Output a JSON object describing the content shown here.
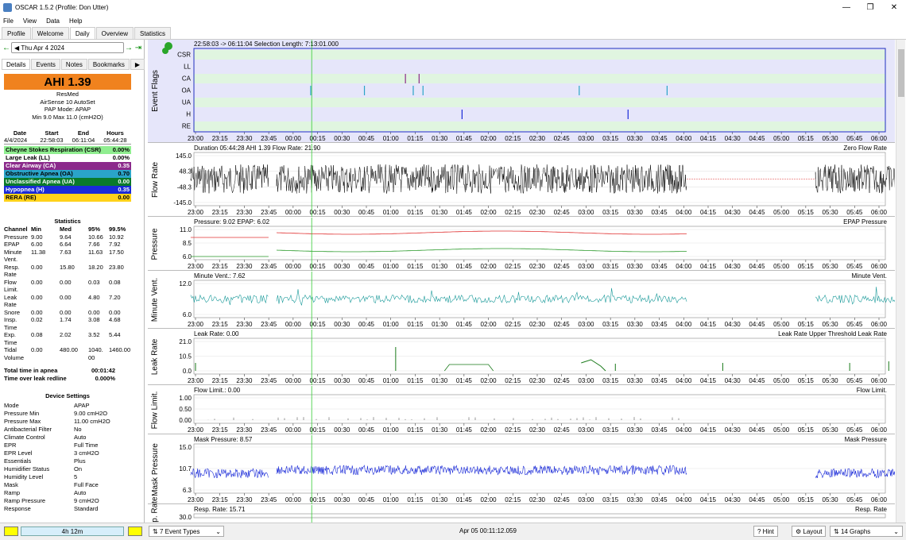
{
  "window": {
    "title": "OSCAR 1.5.2 (Profile: Don Utter)"
  },
  "menu": [
    "File",
    "View",
    "Data",
    "Help"
  ],
  "tabs": [
    "Profile",
    "Welcome",
    "Daily",
    "Overview",
    "Statistics"
  ],
  "active_tab": "Daily",
  "date_nav": {
    "date": "Thu Apr 4 2024"
  },
  "subtabs": [
    "Details",
    "Events",
    "Notes",
    "Bookmarks"
  ],
  "ahi": "AHI 1.39",
  "device": {
    "brand": "ResMed",
    "model": "AirSense 10 AutoSet",
    "mode": "PAP Mode: APAP",
    "pressure": "Min 9.0 Max 11.0 (cmH2O)"
  },
  "summary": {
    "headers": [
      "Date",
      "Start",
      "End",
      "Hours"
    ],
    "row": [
      "4/4/2024",
      "22:58:03",
      "06:11:04",
      "05:44:28"
    ]
  },
  "events": [
    {
      "name": "Cheyne Stokes Respiration (CSR)",
      "value": "0.00%",
      "color": "#90ee90",
      "text": "#000"
    },
    {
      "name": "Large Leak (LL)",
      "value": "0.00%",
      "color": "#ffffff",
      "text": "#000"
    },
    {
      "name": "Clear Airway (CA)",
      "value": "0.35",
      "color": "#8b2a8b",
      "text": "#fff"
    },
    {
      "name": "Obstructive Apnea (OA)",
      "value": "0.70",
      "color": "#2aa4c8",
      "text": "#000"
    },
    {
      "name": "Unclassified Apnea (UA)",
      "value": "0.00",
      "color": "#0a7a2a",
      "text": "#fff"
    },
    {
      "name": "Hypopnea (H)",
      "value": "0.35",
      "color": "#1a2ad8",
      "text": "#fff"
    },
    {
      "name": "RERA (RE)",
      "value": "0.00",
      "color": "#ffd21a",
      "text": "#000"
    }
  ],
  "statistics": {
    "title": "Statistics",
    "headers": [
      "Channel",
      "Min",
      "Med",
      "95%",
      "99.5%"
    ],
    "rows": [
      [
        "Pressure",
        "9.00",
        "9.64",
        "10.66",
        "10.92"
      ],
      [
        "EPAP",
        "6.00",
        "6.64",
        "7.66",
        "7.92"
      ],
      [
        "Minute",
        "11.38",
        "7.63",
        "11.63",
        "17.50"
      ],
      [
        "Vent.",
        "",
        "",
        "",
        ""
      ],
      [
        "Resp.",
        "0.00",
        "15.80",
        "18.20",
        "23.80"
      ],
      [
        "Rate",
        "",
        "",
        "",
        ""
      ],
      [
        "Flow",
        "0.00",
        "0.00",
        "0.03",
        "0.08"
      ],
      [
        "Limit.",
        "",
        "",
        "",
        ""
      ],
      [
        "Leak Rate",
        "0.00",
        "0.00",
        "4.80",
        "7.20"
      ],
      [
        "Snore",
        "0.00",
        "0.00",
        "0.00",
        "0.00"
      ],
      [
        "Insp.",
        "0.02",
        "1.74",
        "3.08",
        "4.68"
      ],
      [
        "Time",
        "",
        "",
        "",
        ""
      ],
      [
        "Exp.",
        "0.08",
        "2.02",
        "3.52",
        "5.44"
      ],
      [
        "Time",
        "",
        "",
        "",
        ""
      ],
      [
        "Tidal",
        "0.00",
        "480.00",
        "1040.",
        "1460.00"
      ],
      [
        "Volume",
        "",
        "",
        "00",
        ""
      ]
    ]
  },
  "apnea": [
    {
      "label": "Total time in apnea",
      "value": "00:01:42"
    },
    {
      "label": "Time over leak redline",
      "value": "0.000%"
    }
  ],
  "device_settings": {
    "title": "Device Settings",
    "rows": [
      [
        "Mode",
        "APAP"
      ],
      [
        "Pressure Min",
        "9.00 cmH2O"
      ],
      [
        "Pressure Max",
        "11.00 cmH2O"
      ],
      [
        "Antibacterial Filter",
        "No"
      ],
      [
        "Climate Control",
        "Auto"
      ],
      [
        "EPR",
        "Full Time"
      ],
      [
        "EPR Level",
        "3 cmH2O"
      ],
      [
        "Essentials",
        "Plus"
      ],
      [
        "Humidifier Status",
        "On"
      ],
      [
        "Humidity Level",
        "5"
      ],
      [
        "Mask",
        "Full Face"
      ],
      [
        "Ramp",
        "Auto"
      ],
      [
        "Ramp Pressure",
        "9 cmH2O"
      ],
      [
        "Response",
        "Standard"
      ]
    ]
  },
  "bottom": {
    "time_bar": "4h 12m",
    "event_types": "7 Event Types",
    "cursor_time": "Apr 05 00:11:12.059",
    "hint": "Hint",
    "layout": "Layout",
    "graphs": "14 Graphs"
  },
  "time_ticks": [
    "23:00",
    "23:15",
    "23:30",
    "23:45",
    "00:00",
    "00:15",
    "00:30",
    "00:45",
    "01:00",
    "01:15",
    "01:30",
    "01:45",
    "02:00",
    "02:15",
    "02:30",
    "02:45",
    "03:00",
    "03:15",
    "03:30",
    "03:45",
    "04:00",
    "04:15",
    "04:30",
    "04:45",
    "05:00",
    "05:15",
    "05:30",
    "05:45",
    "06:00"
  ],
  "charts": [
    {
      "id": "flags",
      "label": "Event Flags",
      "header": "22:58:03 -> 06:11:04     Selection Length: 7:13:01.000",
      "legend": "",
      "rows": [
        "CSR",
        "LL",
        "CA",
        "OA",
        "UA",
        "H",
        "RE"
      ]
    },
    {
      "id": "flow",
      "label": "Flow Rate",
      "header": "Duration 05:44:28 AHI 1.39 Flow Rate: 21.90",
      "legend": "Zero  Flow Rate",
      "yticks": [
        "145.0",
        "48.3",
        "-48.3",
        "-145.0"
      ]
    },
    {
      "id": "pressure",
      "label": "Pressure",
      "header": "Pressure: 9.02 EPAP: 6.02",
      "legend": "EPAP  Pressure",
      "yticks": [
        "11.0",
        "8.5",
        "6.0"
      ]
    },
    {
      "id": "minvent",
      "label": "Minute Vent.",
      "header": "Minute Vent.: 7.62",
      "legend": "Minute Vent.",
      "yticks": [
        "12.0",
        "6.0"
      ]
    },
    {
      "id": "leak",
      "label": "Leak Rate",
      "header": "Leak Rate: 0.00",
      "legend": "Leak Rate Upper Threshold  Leak Rate",
      "yticks": [
        "21.0",
        "10.5",
        "0.0"
      ]
    },
    {
      "id": "flowlim",
      "label": "Flow Limit.",
      "header": "Flow Limit.: 0.00",
      "legend": "Flow Limit.",
      "yticks": [
        "1.00",
        "0.50",
        "0.00"
      ]
    },
    {
      "id": "mask",
      "label": "Mask Pressure",
      "header": "Mask Pressure: 8.57",
      "legend": "Mask Pressure",
      "yticks": [
        "15.0",
        "10.7",
        "6.3"
      ]
    },
    {
      "id": "resp",
      "label": "Resp. Rate",
      "header": "Resp. Rate: 15.71",
      "legend": "Resp. Rate",
      "yticks": [
        "30.0"
      ]
    }
  ],
  "colors": {
    "flags_bg": "#e6e6fa",
    "flag_row": "#e0f5e0",
    "accent_ahi": "#f0821e",
    "pressure": "#e03030",
    "epap": "#2a9a2a",
    "minvent": "#1a9a9a",
    "leak": "#1a7a1a",
    "mask": "#1a2ad8",
    "cursor": "#33cc33"
  }
}
